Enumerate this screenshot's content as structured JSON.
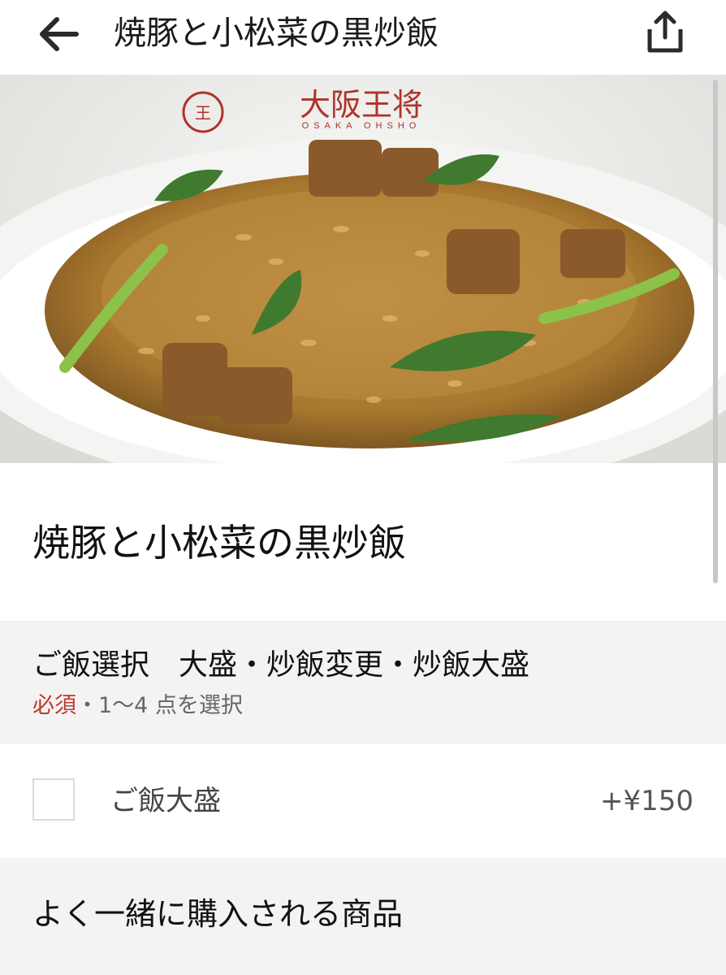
{
  "header": {
    "title": "焼豚と小松菜の黒炒飯",
    "back_icon": "arrow-left-icon",
    "share_icon": "share-upload-icon"
  },
  "hero": {
    "brand_text": "大阪王将",
    "brand_subtext": "OSAKA OHSHO"
  },
  "item": {
    "title": "焼豚と小松菜の黒炒飯"
  },
  "option_group": {
    "title": "ご飯選択　大盛・炒飯変更・炒飯大盛",
    "required_label": "必須",
    "rule_text": "・1〜4 点を選択",
    "required_color": "#c0392b",
    "options": [
      {
        "label": "ご飯大盛",
        "price": "+¥150",
        "checked": false
      }
    ]
  },
  "related": {
    "title": "よく一緒に購入される商品"
  }
}
